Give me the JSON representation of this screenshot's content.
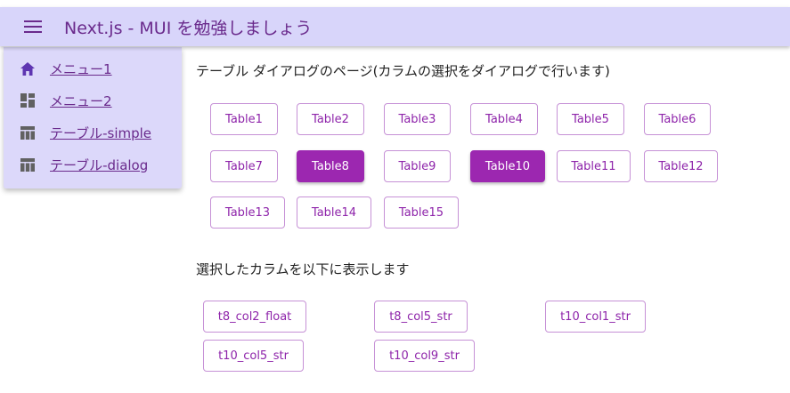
{
  "appbar": {
    "title": "Next.js - MUI を勉強しましょう",
    "menu_icon": "hamburger-menu-icon"
  },
  "drawer": {
    "items": [
      {
        "label": "メニュー1",
        "icon": "home-icon"
      },
      {
        "label": "メニュー2",
        "icon": "dashboard-icon"
      },
      {
        "label": "テーブル-simple",
        "icon": "table-icon"
      },
      {
        "label": "テーブル-dialog",
        "icon": "table-icon"
      }
    ]
  },
  "main": {
    "heading": "テーブル ダイアログのページ(カラムの選択をダイアログで行います)",
    "tables": [
      {
        "label": "Table1",
        "selected": false
      },
      {
        "label": "Table2",
        "selected": false
      },
      {
        "label": "Table3",
        "selected": false
      },
      {
        "label": "Table4",
        "selected": false
      },
      {
        "label": "Table5",
        "selected": false
      },
      {
        "label": "Table6",
        "selected": false
      },
      {
        "label": "Table7",
        "selected": false
      },
      {
        "label": "Table8",
        "selected": true
      },
      {
        "label": "Table9",
        "selected": false
      },
      {
        "label": "Table10",
        "selected": true
      },
      {
        "label": "Table11",
        "selected": false
      },
      {
        "label": "Table12",
        "selected": false
      },
      {
        "label": "Table13",
        "selected": false
      },
      {
        "label": "Table14",
        "selected": false
      },
      {
        "label": "Table15",
        "selected": false
      }
    ],
    "selected_heading": "選択したカラムを以下に表示します",
    "selected_columns": [
      "t8_col2_float",
      "t8_col5_str",
      "t10_col1_str",
      "t10_col5_str",
      "t10_col9_str"
    ]
  },
  "colors": {
    "appbar_bg": "#d8d5fa",
    "drawer_bg": "#dcd8fa",
    "accent": "#9c27b0",
    "accent_text": "#8e24aa",
    "title_text": "#6a2a8c"
  }
}
